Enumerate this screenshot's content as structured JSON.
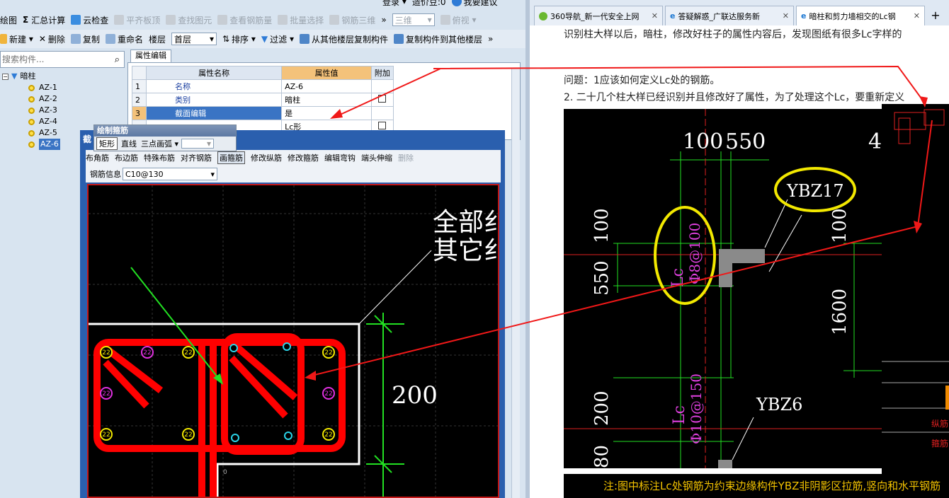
{
  "top_menu": {
    "login": "登录",
    "zaojia": "造价豆:0",
    "suggest": "我要建议"
  },
  "toolbar1": {
    "draw": "绘图",
    "sum": "汇总计算",
    "cloud": "云检查",
    "level_top": "平齐板顶",
    "find": "查找图元",
    "view_rebar": "查看钢筋量",
    "batch": "批量选择",
    "rebar3d": "钢筋三维",
    "view3d": "三维",
    "top_view": "俯视"
  },
  "toolbar2": {
    "new": "新建",
    "delete": "删除",
    "copy": "复制",
    "rename": "重命名",
    "floor_label": "楼层",
    "floor_value": "首层",
    "sort": "排序",
    "filter": "过滤",
    "copy_from": "从其他楼层复制构件",
    "copy_to": "复制构件到其他楼层"
  },
  "search": {
    "placeholder": "搜索构件..."
  },
  "tree": {
    "root": "暗柱",
    "items": [
      "AZ-1",
      "AZ-2",
      "AZ-3",
      "AZ-4",
      "AZ-5",
      "AZ-6"
    ]
  },
  "prop_tab": "属性编辑",
  "prop_table": {
    "headers": [
      "属性名称",
      "属性值",
      "附加"
    ],
    "rows": [
      {
        "num": "1",
        "name": "名称",
        "value": "AZ-6"
      },
      {
        "num": "2",
        "name": "类别",
        "value": "暗柱"
      },
      {
        "num": "3",
        "name": "截面编辑",
        "value": "是"
      },
      {
        "num": "4",
        "name": "",
        "value": "Lc形"
      }
    ]
  },
  "draw_popup": {
    "title": "绘制箍筋",
    "rect": "矩形",
    "line": "直线",
    "arc": "三点画弧"
  },
  "dialog": {
    "title": "截",
    "tools": [
      "布角筋",
      "布边筋",
      "特殊布筋",
      "对齐钢筋",
      "画箍筋",
      "修改纵筋",
      "修改箍筋",
      "编辑弯钩",
      "端头伸缩",
      "删除"
    ],
    "rebar_label": "钢筋信息",
    "rebar_value": "C10@130"
  },
  "canvas": {
    "text1": "全部纟",
    "text2": "其它纟",
    "dim": "200",
    "num22": "22",
    "zero": "0"
  },
  "browser_tabs": [
    "360导航_新一代安全上网",
    "答疑解惑_广联达服务新",
    "暗柱和剪力墙相交的Lc钢"
  ],
  "article": {
    "line1": "识别柱大样以后，暗柱，修改好柱子的属性内容后，发现图纸有很多Lc字样的",
    "line2": "问题：1应该如何定义Lc处的钢筋。",
    "line3": "2.  二十几个柱大样已经识别并且修改好了属性，为了处理这个Lc，要重新定义"
  },
  "cad": {
    "d100": "100",
    "d550": "550",
    "d4": "4",
    "ybz17": "YBZ17",
    "ybz6": "YBZ6",
    "v100": "100",
    "v550": "550",
    "v1600": "1600",
    "v200": "200",
    "lc1": "Lc",
    "rebar1": "Φ8@100",
    "lc2": "Lc",
    "rebar2": "Φ10@150",
    "red1": "纵筋",
    "red2": "箍筋",
    "v80": "80"
  },
  "note": "注:图中标注Lc处钢筋为约束边缘构件YBZ非阴影区拉筋,竖向和水平钢筋"
}
